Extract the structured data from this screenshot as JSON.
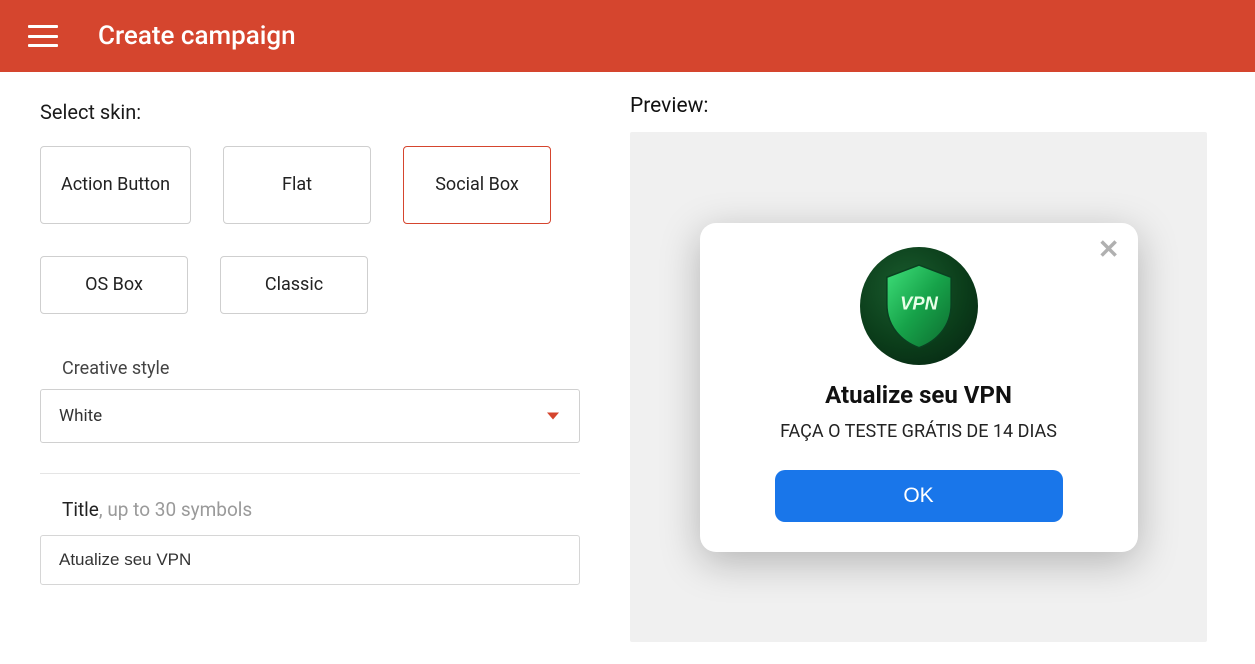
{
  "header": {
    "title": "Create campaign"
  },
  "skin": {
    "label": "Select skin:",
    "options": [
      "Action Button",
      "Flat",
      "Social Box",
      "OS Box",
      "Classic"
    ],
    "selected": "Social Box"
  },
  "creative_style": {
    "label": "Creative style",
    "value": "White"
  },
  "title_field": {
    "label": "Title",
    "hint": ", up to 30 symbols",
    "value": "Atualize seu VPN"
  },
  "preview": {
    "label": "Preview:",
    "icon_text": "VPN",
    "title": "Atualize seu VPN",
    "subtitle": "FAÇA O TESTE GRÁTIS DE 14 DIAS",
    "button": "OK"
  }
}
